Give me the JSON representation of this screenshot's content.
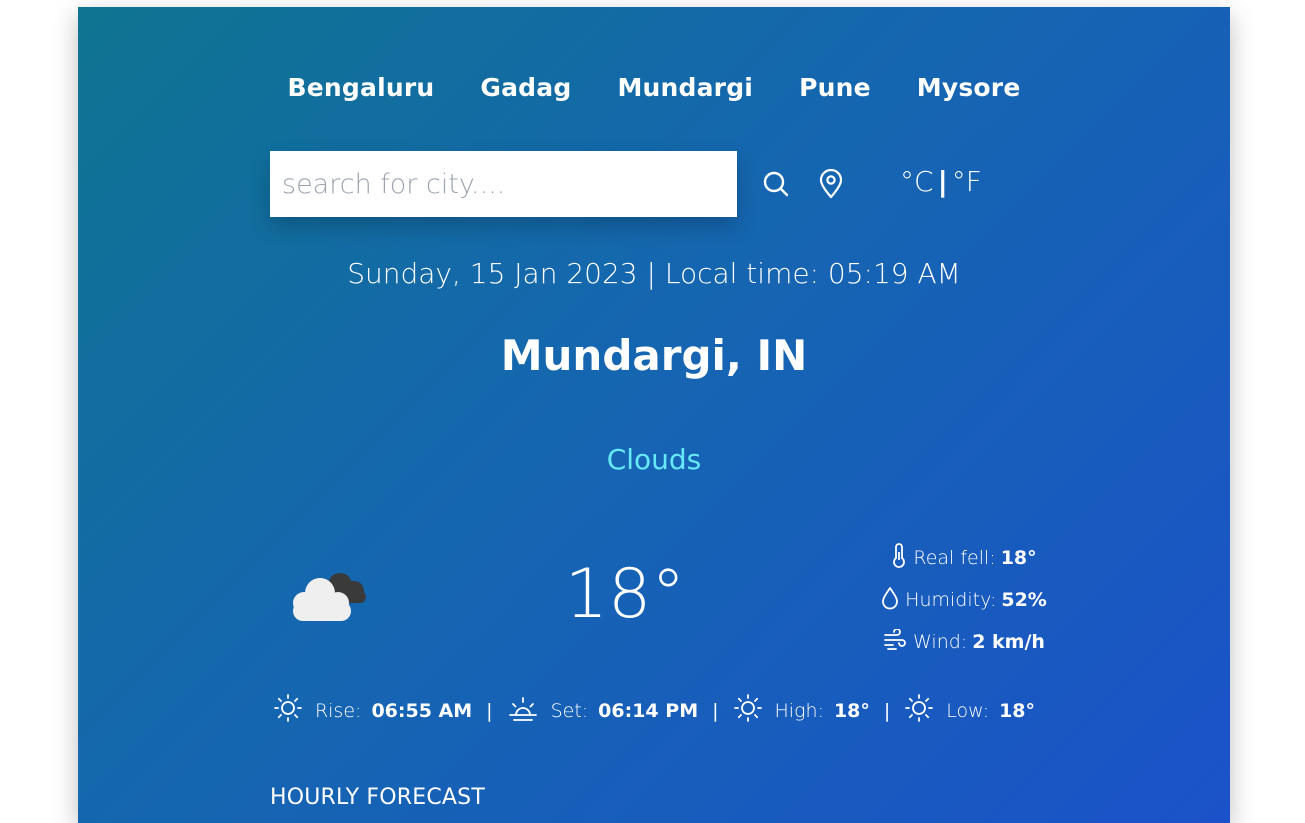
{
  "cities": [
    "Bengaluru",
    "Gadag",
    "Mundargi",
    "Pune",
    "Mysore"
  ],
  "search": {
    "placeholder": "search for city....",
    "value": ""
  },
  "icons": {
    "search": "search-icon",
    "location": "map-pin-icon",
    "weather": "clouds-icon",
    "thermometer": "thermometer-icon",
    "humidity": "droplet-icon",
    "wind": "wind-icon",
    "sunrise": "sun-icon",
    "sunset": "sunset-icon",
    "high": "sun-icon",
    "low": "sun-icon"
  },
  "units": {
    "celsius": "°C",
    "fahrenheit": "°F",
    "separator": "|"
  },
  "datetime": "Sunday, 15 Jan 2023 | Local time: 05:19 AM",
  "location": "Mundargi, IN",
  "condition": "Clouds",
  "temperature": "18°",
  "details": {
    "real_feel": {
      "label": "Real fell:",
      "value": "18°"
    },
    "humidity": {
      "label": "Humidity:",
      "value": "52%"
    },
    "wind": {
      "label": "Wind:",
      "value": "2 km/h"
    }
  },
  "sun": {
    "rise": {
      "label": "Rise:",
      "value": "06:55 AM"
    },
    "set": {
      "label": "Set:",
      "value": "06:14 PM"
    },
    "high": {
      "label": "High:",
      "value": "18°"
    },
    "low": {
      "label": "Low:",
      "value": "18°"
    },
    "separator": "|"
  },
  "hourly_title": "HOURLY FORECAST",
  "colors": {
    "gradient_start": "#0f7491",
    "gradient_end": "#1b52c9",
    "condition": "#67e8f9"
  }
}
